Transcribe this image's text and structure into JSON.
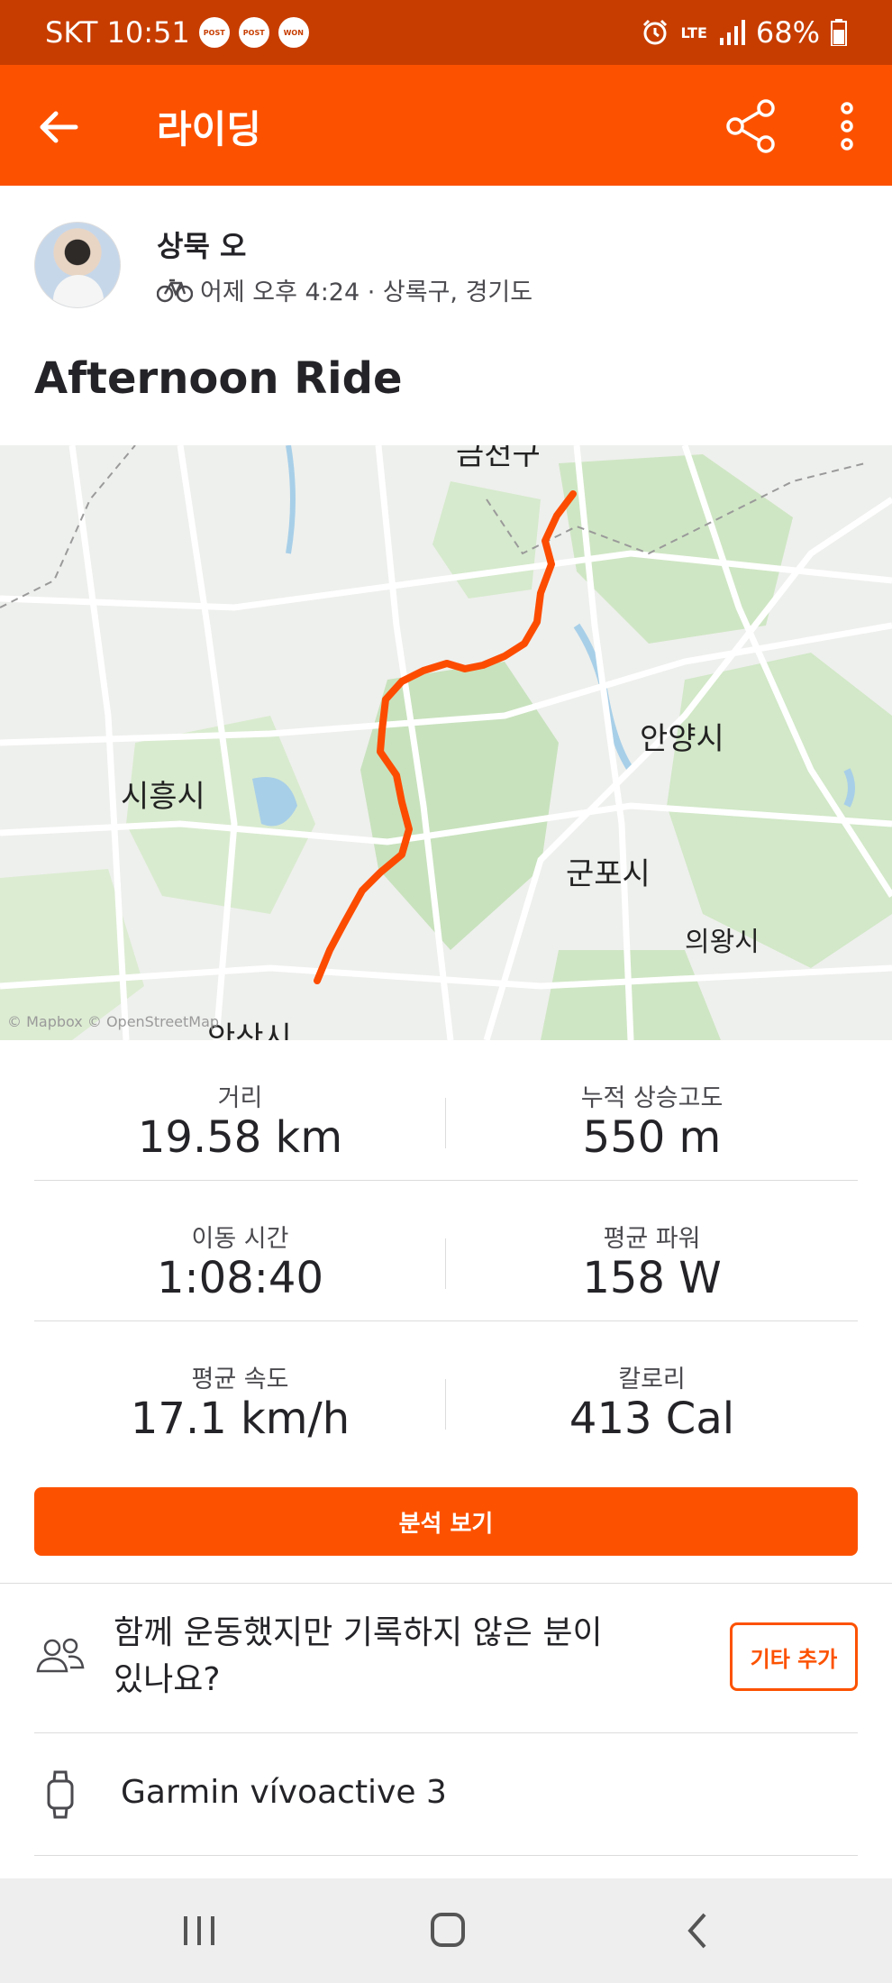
{
  "status_bar": {
    "carrier_time": "SKT 10:51",
    "badges": [
      "POST",
      "POST",
      "WON"
    ],
    "network": "LTE",
    "battery": "68%"
  },
  "app_bar": {
    "title": "라이딩",
    "icons": [
      "back-arrow-icon",
      "share-icon",
      "more-vertical-icon"
    ]
  },
  "athlete": {
    "name": "상묵 오",
    "meta": "어제 오후 4:24 · 상록구, 경기도",
    "activity_icon": "bike-icon"
  },
  "activity": {
    "title": "Afternoon Ride"
  },
  "map": {
    "labels": {
      "top": "금천구",
      "anyang": "안양시",
      "siheung": "시흥시",
      "gunpo": "군포시",
      "uiwang": "의왕시",
      "ansan": "안산시"
    },
    "attribution": "© Mapbox © OpenStreetMap",
    "route_color": "#fc4c02"
  },
  "stats": [
    {
      "label": "거리",
      "value": "19.58 km"
    },
    {
      "label": "누적 상승고도",
      "value": "550 m"
    },
    {
      "label": "이동 시간",
      "value": "1:08:40"
    },
    {
      "label": "평균 파워",
      "value": "158 W"
    },
    {
      "label": "평균 속도",
      "value": "17.1 km/h"
    },
    {
      "label": "칼로리",
      "value": "413 Cal"
    }
  ],
  "analysis_button": "분석 보기",
  "others": {
    "text": "함께 운동했지만 기록하지 않은 분이 있나요?",
    "button": "기타 추가"
  },
  "device": {
    "name": "Garmin vívoactive 3"
  },
  "colors": {
    "brand": "#fc5200",
    "status_bar": "#c73d00"
  }
}
